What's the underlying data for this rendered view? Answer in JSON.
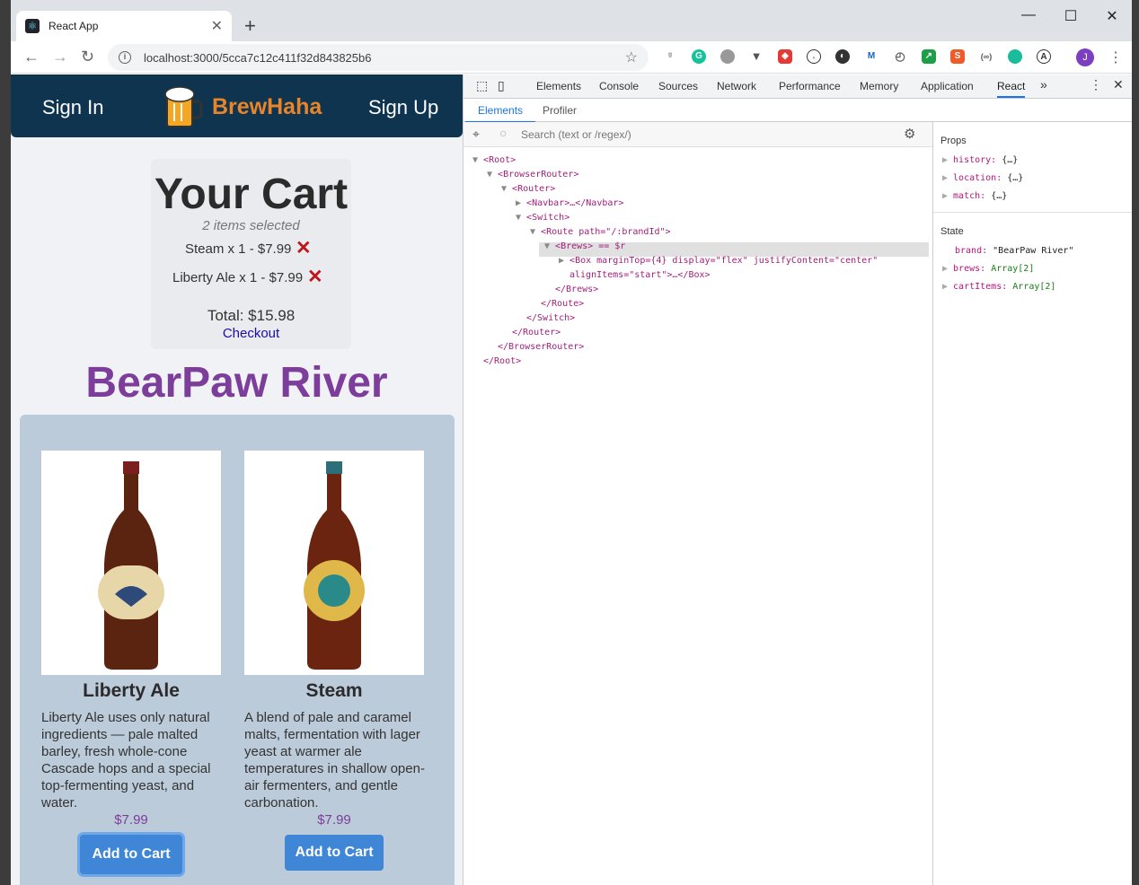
{
  "browser": {
    "tab_title": "React App",
    "url": "localhost:3000/5cca7c12c411f32d843825b6",
    "avatar_letter": "J"
  },
  "app": {
    "nav": {
      "sign_in": "Sign In",
      "brand": "BrewHaha",
      "sign_up": "Sign Up"
    },
    "cart": {
      "title": "Your Cart",
      "selected": "2 items selected",
      "items": [
        "Steam x 1 - $7.99",
        "Liberty Ale x 1 - $7.99"
      ],
      "total": "Total: $15.98",
      "checkout": "Checkout"
    },
    "brand_heading": "BearPaw River",
    "brews": [
      {
        "name": "Liberty Ale",
        "description": "Liberty Ale uses only natural ingredients — pale malted barley, fresh whole-cone Cascade hops and a special top-fermenting yeast, and water.",
        "price": "$7.99",
        "button": "Add to Cart"
      },
      {
        "name": "Steam",
        "description": "A blend of pale and caramel malts, fermentation with lager yeast at warmer ale temperatures in shallow open-air fermenters, and gentle carbonation.",
        "price": "$7.99",
        "button": "Add to Cart"
      }
    ]
  },
  "devtools": {
    "tabs": [
      "Elements",
      "Console",
      "Sources",
      "Network",
      "Performance",
      "Memory",
      "Application",
      "React"
    ],
    "active_tab": "React",
    "subtabs": [
      "Elements",
      "Profiler"
    ],
    "search_placeholder": "Search (text or /regex/)",
    "tree": [
      "<Root>",
      "<BrowserRouter>",
      "<Router>",
      "<Navbar>…</Navbar>",
      "<Switch>",
      "<Route path=\"/:brandId\">",
      "<Brews> == $r",
      "<Box marginTop={4} display=\"flex\" justifyContent=\"center\"",
      "alignItems=\"start\">…</Box>",
      "</Brews>",
      "</Route>",
      "</Switch>",
      "</Router>",
      "</BrowserRouter>",
      "</Root>"
    ],
    "props_header": "Props",
    "props": [
      {
        "key": "history:",
        "value": "{…}"
      },
      {
        "key": "location:",
        "value": "{…}"
      },
      {
        "key": "match:",
        "value": "{…}"
      }
    ],
    "state_header": "State",
    "state": [
      {
        "key": "brand:",
        "value": "\"BearPaw River\""
      },
      {
        "key": "brews:",
        "value": "Array[2]"
      },
      {
        "key": "cartItems:",
        "value": "Array[2]"
      }
    ]
  }
}
